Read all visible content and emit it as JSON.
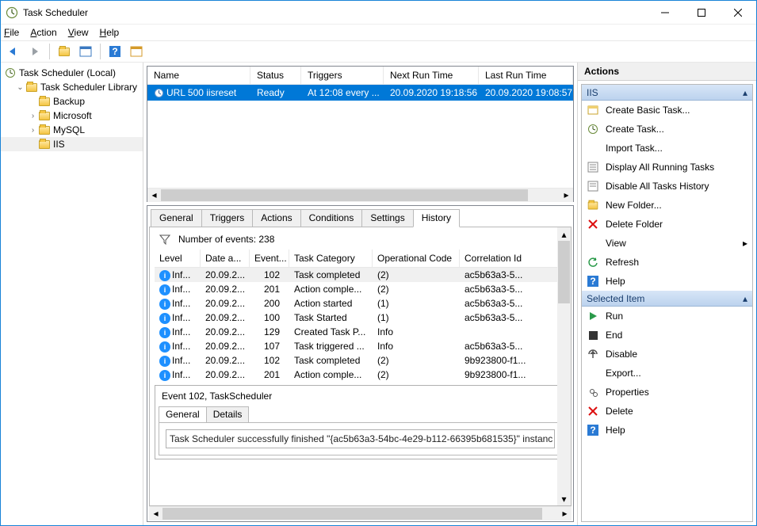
{
  "window": {
    "title": "Task Scheduler"
  },
  "menu": {
    "file": "File",
    "action": "Action",
    "view": "View",
    "help": "Help"
  },
  "tree": {
    "root": "Task Scheduler (Local)",
    "library": "Task Scheduler Library",
    "items": [
      "Backup",
      "Microsoft",
      "MySQL",
      "IIS"
    ]
  },
  "task_columns": {
    "name": "Name",
    "status": "Status",
    "triggers": "Triggers",
    "next": "Next Run Time",
    "last": "Last Run Time"
  },
  "task_row": {
    "name": "URL 500 iisreset",
    "status": "Ready",
    "triggers": "At 12:08 every ...",
    "next": "20.09.2020 19:18:56",
    "last": "20.09.2020 19:08:57"
  },
  "detail_tabs": {
    "general": "General",
    "triggers": "Triggers",
    "actions": "Actions",
    "conditions": "Conditions",
    "settings": "Settings",
    "history": "History"
  },
  "history": {
    "count_label": "Number of events: 238",
    "columns": {
      "level": "Level",
      "date": "Date a...",
      "event": "Event...",
      "category": "Task Category",
      "opcode": "Operational Code",
      "corr": "Correlation Id"
    },
    "rows": [
      {
        "level": "Inf...",
        "date": "20.09.2...",
        "event": "102",
        "category": "Task completed",
        "opcode": "(2)",
        "corr": "ac5b63a3-5..."
      },
      {
        "level": "Inf...",
        "date": "20.09.2...",
        "event": "201",
        "category": "Action comple...",
        "opcode": "(2)",
        "corr": "ac5b63a3-5..."
      },
      {
        "level": "Inf...",
        "date": "20.09.2...",
        "event": "200",
        "category": "Action started",
        "opcode": "(1)",
        "corr": "ac5b63a3-5..."
      },
      {
        "level": "Inf...",
        "date": "20.09.2...",
        "event": "100",
        "category": "Task Started",
        "opcode": "(1)",
        "corr": "ac5b63a3-5..."
      },
      {
        "level": "Inf...",
        "date": "20.09.2...",
        "event": "129",
        "category": "Created Task P...",
        "opcode": "Info",
        "corr": ""
      },
      {
        "level": "Inf...",
        "date": "20.09.2...",
        "event": "107",
        "category": "Task triggered ...",
        "opcode": "Info",
        "corr": "ac5b63a3-5..."
      },
      {
        "level": "Inf...",
        "date": "20.09.2...",
        "event": "102",
        "category": "Task completed",
        "opcode": "(2)",
        "corr": "9b923800-f1..."
      },
      {
        "level": "Inf...",
        "date": "20.09.2...",
        "event": "201",
        "category": "Action comple...",
        "opcode": "(2)",
        "corr": "9b923800-f1..."
      }
    ],
    "event_header": "Event 102, TaskScheduler",
    "subtabs": {
      "general": "General",
      "details": "Details"
    },
    "message": "Task Scheduler successfully finished \"{ac5b63a3-54bc-4e29-b112-66395b681535}\" instanc"
  },
  "actions": {
    "title": "Actions",
    "section1": "IIS",
    "items1": [
      "Create Basic Task...",
      "Create Task...",
      "Import Task...",
      "Display All Running Tasks",
      "Disable All Tasks History",
      "New Folder...",
      "Delete Folder",
      "View",
      "Refresh",
      "Help"
    ],
    "section2": "Selected Item",
    "items2": [
      "Run",
      "End",
      "Disable",
      "Export...",
      "Properties",
      "Delete",
      "Help"
    ]
  }
}
